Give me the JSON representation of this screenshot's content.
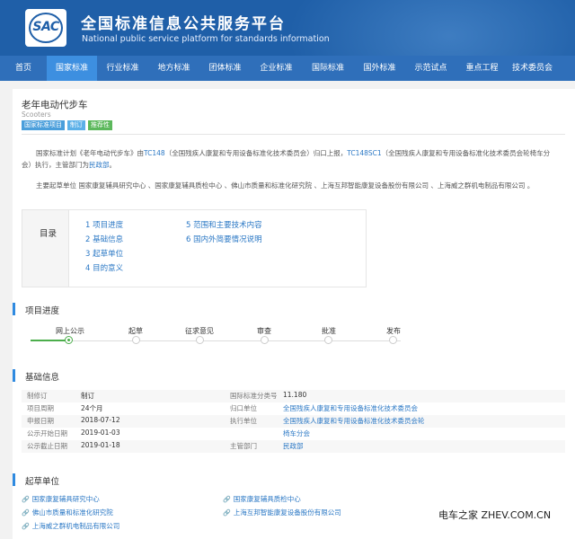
{
  "site": {
    "logo_text": "SAC",
    "title": "全国标准信息公共服务平台",
    "subtitle": "National public service platform  for standards information"
  },
  "nav": [
    {
      "label": "首页",
      "active": false
    },
    {
      "label": "国家标准",
      "active": true
    },
    {
      "label": "行业标准",
      "active": false
    },
    {
      "label": "地方标准",
      "active": false
    },
    {
      "label": "团体标准",
      "active": false
    },
    {
      "label": "企业标准",
      "active": false
    },
    {
      "label": "国际标准",
      "active": false
    },
    {
      "label": "国外标准",
      "active": false
    },
    {
      "label": "示范试点",
      "active": false
    },
    {
      "label": "重点工程",
      "active": false
    },
    {
      "label": "技术委员会",
      "active": false
    }
  ],
  "standard": {
    "title": "老年电动代步车",
    "title_en": "Scooters",
    "tags": [
      "国家标准项目",
      "制订",
      "推荐性"
    ]
  },
  "description": {
    "line1_a": "国家标准计划《老年电动代步车》由",
    "line1_tc": "TC148",
    "line1_b": "（全国残疾人康复和专用设备标准化技术委员会）归口上报，",
    "line1_sc": "TC148SC1",
    "line1_c": "（全国残疾人康复和专用设备标准化技术委员会轮椅车分",
    "line2_a": "会）执行，主管部门为",
    "line2_dept": "民政部",
    "line2_b": "。",
    "drafters_line": "主要起草单位 国家康复辅具研究中心 、国家康复辅具质检中心 、佛山市质量和标准化研究院 、上海互邦智能康复设备股份有限公司 、上海威之群机电制品有限公司 。"
  },
  "toc": {
    "heading": "目录",
    "items": [
      "1 项目进度",
      "2 基础信息",
      "3 起草单位",
      "4 目的意义",
      "5 范围和主要技术内容",
      "6 国内外简要情况说明"
    ]
  },
  "progress": {
    "heading": "项目进度",
    "steps": [
      {
        "label": "网上公示",
        "done": true
      },
      {
        "label": "起草",
        "done": false
      },
      {
        "label": "征求意见",
        "done": false
      },
      {
        "label": "审查",
        "done": false
      },
      {
        "label": "批准",
        "done": false
      },
      {
        "label": "发布",
        "done": false
      }
    ]
  },
  "basic_info": {
    "heading": "基础信息",
    "rows": [
      {
        "l1": "制修订",
        "v1": "制订",
        "l2": "国际标准分类号",
        "v2": "11.180",
        "v2_link": false
      },
      {
        "l1": "项目周期",
        "v1": "24个月",
        "l2": "归口单位",
        "v2": "全国残疾人康复和专用设备标准化技术委员会",
        "v2_link": true
      },
      {
        "l1": "申报日期",
        "v1": "2018-07-12",
        "l2": "执行单位",
        "v2": "全国残疾人康复和专用设备标准化技术委员会轮",
        "v2_link": true
      },
      {
        "l1": "公示开始日期",
        "v1": "2019-01-03",
        "l2": "",
        "v2": "椅车分会",
        "v2_link": true
      },
      {
        "l1": "公示截止日期",
        "v1": "2019-01-18",
        "l2": "主管部门",
        "v2": "民政部",
        "v2_link": true
      }
    ]
  },
  "drafting_units": {
    "heading": "起草单位",
    "items": [
      "国家康复辅具研究中心",
      "国家康复辅具质检中心",
      "佛山市质量和标准化研究院",
      "上海互邦智能康复设备股份有限公司",
      "上海威之群机电制品有限公司"
    ]
  },
  "watermark": "电车之家 ZHEV.COM.CN",
  "colors": {
    "header_bg": "#1f5fa8",
    "nav_bg": "#2f6fba",
    "nav_active": "#3d8fe0",
    "link": "#2b78c5",
    "progress_done": "#4cae4c"
  }
}
